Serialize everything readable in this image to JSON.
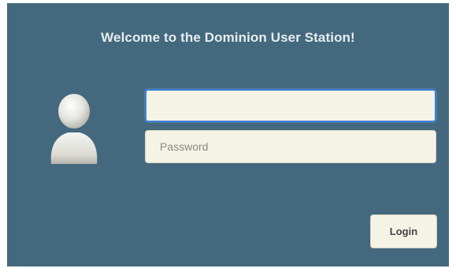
{
  "window": {
    "background_color": "#44697e"
  },
  "header": {
    "title": "Welcome to the Dominion User Station!"
  },
  "login_form": {
    "username": {
      "value": "",
      "placeholder": "",
      "focused": true
    },
    "password": {
      "value": "",
      "placeholder": "Password"
    },
    "login_button_label": "Login"
  },
  "icons": {
    "avatar": "user-avatar-icon"
  }
}
